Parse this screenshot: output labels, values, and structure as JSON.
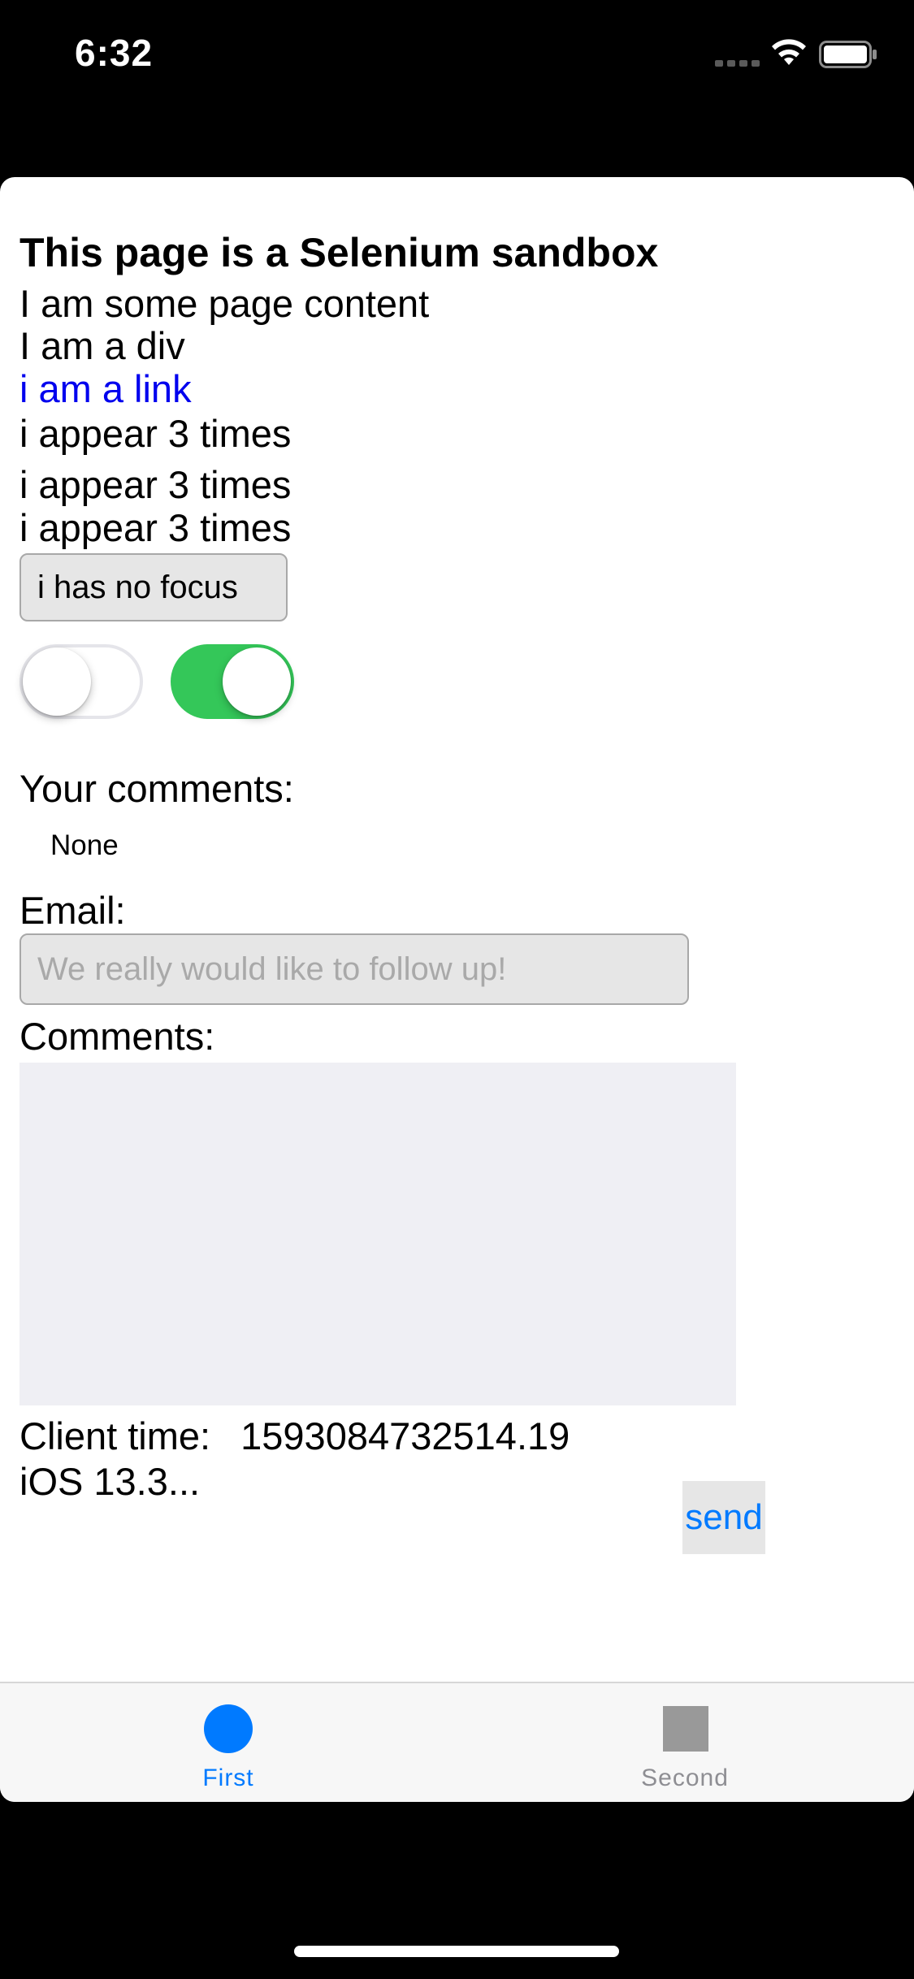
{
  "status_bar": {
    "time": "6:32",
    "icons": [
      "signal-dots-icon",
      "wifi-icon",
      "battery-icon"
    ]
  },
  "page": {
    "heading": "This page is a Selenium sandbox",
    "content_line": "I am some page content",
    "div_line": "I am a div",
    "link_text": "i am a link",
    "repeated_lines": [
      "i appear 3 times",
      "i appear 3 times",
      "i appear 3 times"
    ],
    "focus_button_label": "i has no focus",
    "switches": [
      {
        "name": "switch-off",
        "on": false
      },
      {
        "name": "switch-on",
        "on": true
      }
    ],
    "comments_label": "Your comments:",
    "comments_value": "None",
    "email_label": "Email:",
    "email_placeholder": "We really would like to follow up!",
    "comments_field_label": "Comments:",
    "client_time_label": "Client time:",
    "client_time_value": "1593084732514.19",
    "ios_version": "iOS 13.3...",
    "send_label": "send"
  },
  "tab_bar": {
    "tabs": [
      {
        "label": "First",
        "icon": "circle-icon",
        "selected": true
      },
      {
        "label": "Second",
        "icon": "square-icon",
        "selected": false
      }
    ]
  },
  "colors": {
    "accent": "#007aff",
    "link": "#0000ee",
    "switch_on": "#34c759",
    "input_bg": "#e6e6e6",
    "textarea_bg": "#efeff4"
  }
}
